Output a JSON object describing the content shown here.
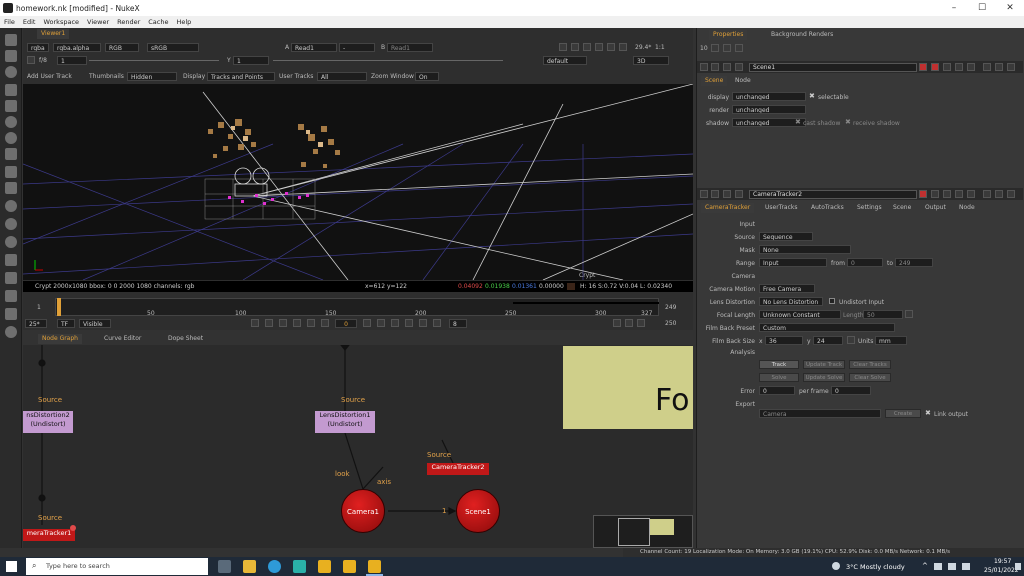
{
  "window": {
    "title": "homework.nk [modified] - NukeX",
    "controls": [
      "–",
      "☐",
      "✕"
    ]
  },
  "menu": [
    "File",
    "Edit",
    "Workspace",
    "Viewer",
    "Render",
    "Cache",
    "Help"
  ],
  "viewer": {
    "tab": "Viewer1",
    "channels": "rgba",
    "channel_alpha": "rgba.alpha",
    "colorspace_rgb": "RGB",
    "lut": "sRGB",
    "input_a_label": "A",
    "input_a": "Read1",
    "input_dash": "-",
    "input_b_label": "B",
    "input_b": "Read1",
    "fstop": "f/8",
    "frame_inc": "1",
    "y_label": "Y",
    "y_value": "1",
    "fps": "29.4*",
    "zoom": "1:1",
    "proxy": "default",
    "mode": "3D",
    "add_user_track": "Add User Track",
    "thumbnails_label": "Thumbnails",
    "thumbnails": "Hidden",
    "display_label": "Display",
    "display": "Tracks and Points",
    "user_tracks_label": "User Tracks",
    "user_tracks": "All",
    "zoom_window_label": "Zoom Window",
    "zoom_window": "On",
    "crypt_label": "Crypt",
    "info_left": "Crypt 2000x1080  bbox: 0 0 2000 1080 channels: rgb",
    "info_coords": "x=612 y=122",
    "info_r": "0.04092",
    "info_g": "0.01938",
    "info_b": "0.01361",
    "info_a": "0.00000",
    "info_hsvl": "H: 16 S:0.72 V:0.04  L: 0.02340"
  },
  "timeline": {
    "start": "1",
    "end": "249",
    "ticks": [
      "50",
      "100",
      "150",
      "200",
      "250",
      "300",
      "327"
    ],
    "gamma": "25*",
    "tf": "TF",
    "visible": "Visible",
    "current_frame": "0",
    "step": "8",
    "end_frame": "250"
  },
  "bottom_tabs": [
    "Node Graph",
    "Curve Editor",
    "Dope Sheet"
  ],
  "nodes": {
    "lensdist2": "nsDistortion2\n(Undistort)",
    "lensdist1": "LensDistortion1\n(Undistort)",
    "camtracker1": "meraTracker1",
    "camtracker2": "CameraTracker2",
    "camera1": "Camera1",
    "scene1": "Scene1",
    "source": "Source",
    "look": "look",
    "axis": "axis",
    "edge_label": "1",
    "backdrop": "Fo"
  },
  "properties": {
    "tab_props": "Properties",
    "tab_bg": "Background Renders",
    "max_panels": "10",
    "scene_panel": {
      "name": "Scene1",
      "tabs": [
        "Scene",
        "Node"
      ],
      "display_label": "display",
      "display": "unchanged",
      "selectable": "selectable",
      "render_label": "render",
      "render": "unchanged",
      "shadow_label": "shadow",
      "shadow": "unchanged",
      "cast_shadow": "cast shadow",
      "receive_shadow": "receive shadow"
    },
    "ct_panel": {
      "name": "CameraTracker2",
      "tabs": [
        "CameraTracker",
        "UserTracks",
        "AutoTracks",
        "Settings",
        "Scene",
        "Output",
        "Node"
      ],
      "input_header": "Input",
      "source_label": "Source",
      "source": "Sequence",
      "mask_label": "Mask",
      "mask": "None",
      "range_label": "Range",
      "range": "Input",
      "from_label": "from",
      "from": "0",
      "to_label": "to",
      "to": "249",
      "camera_header": "Camera",
      "motion_label": "Camera Motion",
      "motion": "Free Camera",
      "lensdist_label": "Lens Distortion",
      "lensdist": "No Lens Distortion",
      "undistort_input": "Undistort Input",
      "focal_label": "Focal Length",
      "focal": "Unknown Constant",
      "length_label": "Length",
      "length": "50",
      "fbpreset_label": "Film Back Preset",
      "fbpreset": "Custom",
      "fbsize_label": "Film Back Size",
      "fb_x_label": "x",
      "fb_x": "36",
      "fb_y_label": "y",
      "fb_y": "24",
      "units_label": "Units",
      "units": "mm",
      "analysis_header": "Analysis",
      "track": "Track",
      "update_track": "Update Track",
      "clear_tracks": "Clear Tracks",
      "solve": "Solve",
      "update_solve": "Update Solve",
      "clear_solve": "Clear Solve",
      "error_label": "Error",
      "error": "0",
      "perframe_label": "per frame",
      "perframe": "0",
      "export_header": "Export",
      "export": "Camera",
      "create": "Create",
      "link_output": "Link output"
    }
  },
  "statusbar": "Channel Count: 19  Localization Mode: On  Memory: 3.0 GB (19.1%)  CPU: 52.9%  Disk: 0.0 MB/s  Network: 0.1 MB/s",
  "taskbar": {
    "search": "Type here to search",
    "weather": "3°C  Mostly cloudy",
    "time": "19:57",
    "date": "25/01/2022"
  },
  "colors": {
    "accent_orange": "#e0a038",
    "node_purple": "#c39ad0",
    "node_red": "#c01818",
    "backdrop": "#cfcf8a"
  }
}
